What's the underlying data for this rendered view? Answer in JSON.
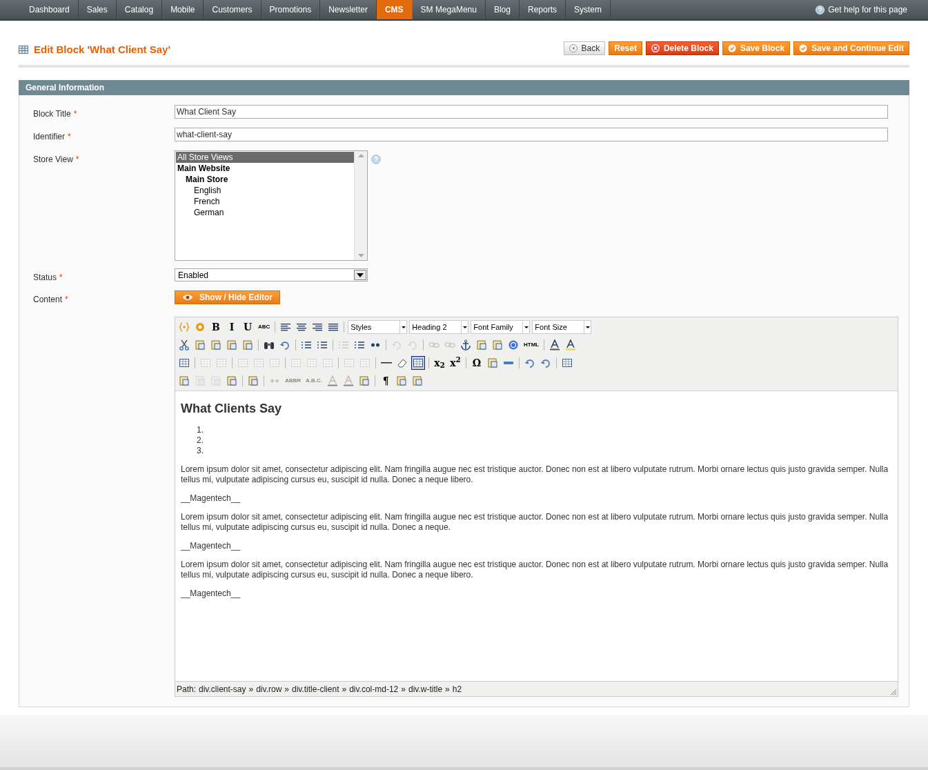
{
  "nav": {
    "items": [
      {
        "label": "Dashboard",
        "selected": false
      },
      {
        "label": "Sales",
        "selected": false
      },
      {
        "label": "Catalog",
        "selected": false
      },
      {
        "label": "Mobile",
        "selected": false
      },
      {
        "label": "Customers",
        "selected": false
      },
      {
        "label": "Promotions",
        "selected": false
      },
      {
        "label": "Newsletter",
        "selected": false
      },
      {
        "label": "CMS",
        "selected": true
      },
      {
        "label": "SM MegaMenu",
        "selected": false
      },
      {
        "label": "Blog",
        "selected": false
      },
      {
        "label": "Reports",
        "selected": false
      },
      {
        "label": "System",
        "selected": false
      }
    ],
    "help": "Get help for this page"
  },
  "header": {
    "title": "Edit Block 'What Client Say'",
    "buttons": [
      {
        "label": "Back",
        "kind": "back"
      },
      {
        "label": "Reset",
        "kind": "plain"
      },
      {
        "label": "Delete Block",
        "kind": "delete"
      },
      {
        "label": "Save Block",
        "kind": "save"
      },
      {
        "label": "Save and Continue Edit",
        "kind": "save"
      }
    ]
  },
  "section": {
    "title": "General Information"
  },
  "form": {
    "block_title": {
      "label": "Block Title",
      "required": "*",
      "value": "What Client Say"
    },
    "identifier": {
      "label": "Identifier",
      "required": "*",
      "value": "what-client-say"
    },
    "store_view": {
      "label": "Store View",
      "required": "*",
      "options": [
        {
          "label": "All Store Views",
          "selected": true,
          "bold": false
        },
        {
          "label": "Main Website",
          "selected": false,
          "bold": true,
          "children": [
            {
              "label": "Main Store",
              "selected": false,
              "bold": true,
              "children": [
                {
                  "label": "English",
                  "selected": false,
                  "bold": false
                },
                {
                  "label": "French",
                  "selected": false,
                  "bold": false
                },
                {
                  "label": "German",
                  "selected": false,
                  "bold": false
                }
              ]
            }
          ]
        }
      ]
    },
    "status": {
      "label": "Status",
      "required": "*",
      "value": "Enabled"
    },
    "content": {
      "label": "Content",
      "required": "*",
      "toggle": "Show / Hide Editor"
    }
  },
  "editor": {
    "toolbar": [
      [
        {
          "kind": "button",
          "disabled": false
        },
        {
          "kind": "button",
          "disabled": false
        },
        {
          "kind": "glyph",
          "text": "B",
          "disabled": false
        },
        {
          "kind": "glyph",
          "text": "I",
          "disabled": false
        },
        {
          "kind": "glyph",
          "text": "U",
          "disabled": false
        },
        {
          "kind": "glyph",
          "text": "ABC",
          "disabled": false
        },
        {
          "kind": "separator"
        },
        {
          "kind": "button",
          "disabled": false
        },
        {
          "kind": "button",
          "disabled": false
        },
        {
          "kind": "button",
          "disabled": false
        },
        {
          "kind": "button",
          "disabled": false
        },
        {
          "kind": "separator"
        },
        {
          "kind": "select",
          "value": "Styles"
        },
        {
          "kind": "select",
          "value": "Heading 2"
        },
        {
          "kind": "select",
          "value": "Font Family"
        },
        {
          "kind": "select",
          "value": "Font Size"
        }
      ],
      [
        {
          "kind": "button",
          "disabled": false
        },
        {
          "kind": "button",
          "disabled": false
        },
        {
          "kind": "button",
          "disabled": false
        },
        {
          "kind": "button",
          "disabled": false
        },
        {
          "kind": "button",
          "disabled": false
        },
        {
          "kind": "separator"
        },
        {
          "kind": "button",
          "disabled": false
        },
        {
          "kind": "button",
          "disabled": false
        },
        {
          "kind": "separator"
        },
        {
          "kind": "button",
          "disabled": false
        },
        {
          "kind": "button",
          "disabled": false
        },
        {
          "kind": "separator"
        },
        {
          "kind": "button",
          "disabled": true
        },
        {
          "kind": "button",
          "disabled": false
        },
        {
          "kind": "button",
          "disabled": false
        },
        {
          "kind": "separator"
        },
        {
          "kind": "button",
          "disabled": true
        },
        {
          "kind": "button",
          "disabled": true
        },
        {
          "kind": "separator"
        },
        {
          "kind": "button",
          "disabled": true
        },
        {
          "kind": "button",
          "disabled": true
        },
        {
          "kind": "button",
          "disabled": false
        },
        {
          "kind": "button",
          "disabled": false
        },
        {
          "kind": "button",
          "disabled": false
        },
        {
          "kind": "button",
          "disabled": false
        },
        {
          "kind": "glyph",
          "text": "HTML",
          "disabled": false
        },
        {
          "kind": "separator"
        },
        {
          "kind": "button",
          "disabled": false
        },
        {
          "kind": "button",
          "disabled": false
        }
      ],
      [
        {
          "kind": "button",
          "disabled": false
        },
        {
          "kind": "separator"
        },
        {
          "kind": "button",
          "disabled": true
        },
        {
          "kind": "button",
          "disabled": true
        },
        {
          "kind": "separator"
        },
        {
          "kind": "button",
          "disabled": true
        },
        {
          "kind": "button",
          "disabled": true
        },
        {
          "kind": "button",
          "disabled": true
        },
        {
          "kind": "separator"
        },
        {
          "kind": "button",
          "disabled": true
        },
        {
          "kind": "button",
          "disabled": true
        },
        {
          "kind": "button",
          "disabled": true
        },
        {
          "kind": "separator"
        },
        {
          "kind": "button",
          "disabled": true
        },
        {
          "kind": "button",
          "disabled": true
        },
        {
          "kind": "separator"
        },
        {
          "kind": "button",
          "disabled": false
        },
        {
          "kind": "button",
          "disabled": false
        },
        {
          "kind": "button",
          "disabled": false,
          "active": true
        },
        {
          "kind": "separator"
        },
        {
          "kind": "glyph",
          "text": "x$_{2}$",
          "disabled": false
        },
        {
          "kind": "glyph",
          "text": "x$^{2}$",
          "disabled": false
        },
        {
          "kind": "separator"
        },
        {
          "kind": "glyph",
          "text": "Ω",
          "disabled": false
        },
        {
          "kind": "button",
          "disabled": false
        },
        {
          "kind": "button",
          "disabled": false
        },
        {
          "kind": "separator"
        },
        {
          "kind": "button",
          "disabled": false
        },
        {
          "kind": "button",
          "disabled": false
        },
        {
          "kind": "separator"
        },
        {
          "kind": "button",
          "disabled": false
        }
      ],
      [
        {
          "kind": "button",
          "disabled": false
        },
        {
          "kind": "button",
          "disabled": true
        },
        {
          "kind": "button",
          "disabled": true
        },
        {
          "kind": "button",
          "disabled": false
        },
        {
          "kind": "separator"
        },
        {
          "kind": "button",
          "disabled": false
        },
        {
          "kind": "separator"
        },
        {
          "kind": "button",
          "disabled": true
        },
        {
          "kind": "glyph",
          "text": "ABBR",
          "disabled": true
        },
        {
          "kind": "glyph",
          "text": "A.B.C.",
          "disabled": true
        },
        {
          "kind": "button",
          "disabled": true
        },
        {
          "kind": "button",
          "disabled": true
        },
        {
          "kind": "button",
          "disabled": false
        },
        {
          "kind": "separator"
        },
        {
          "kind": "glyph",
          "text": "¶",
          "disabled": false
        },
        {
          "kind": "button",
          "disabled": false
        },
        {
          "kind": "button",
          "disabled": false
        }
      ]
    ],
    "content": [
      {
        "kind": "heading",
        "text": "What Clients Say"
      },
      {
        "kind": "list",
        "items": [
          "1.",
          "2.",
          "3."
        ]
      },
      {
        "kind": "paragraph",
        "text": "Lorem ipsum dolor sit amet, consectetur adipiscing elit. Nam fringilla augue nec est tristique auctor. Donec non est at libero vulputate rutrum. Morbi ornare lectus quis justo gravida semper. Nulla tellus mi, vulputate adipiscing cursus eu, suscipit id nulla. Donec a neque libero."
      },
      {
        "kind": "paragraph",
        "text": "__Magentech__"
      },
      {
        "kind": "paragraph",
        "text": "Lorem ipsum dolor sit amet, consectetur adipiscing elit. Nam fringilla augue nec est tristique auctor. Donec non est at libero vulputate rutrum. Morbi ornare lectus quis justo gravida semper. Nulla tellus mi, vulputate adipiscing cursus eu, suscipit id nulla. Donec a neque."
      },
      {
        "kind": "paragraph",
        "text": "__Magentech__"
      },
      {
        "kind": "paragraph",
        "text": "Lorem ipsum dolor sit amet, consectetur adipiscing elit. Nam fringilla augue nec est tristique auctor. Donec non est at libero vulputate rutrum. Morbi ornare lectus quis justo gravida semper. Nulla tellus mi, vulputate adipiscing cursus eu, suscipit id nulla. Donec a neque libero."
      },
      {
        "kind": "paragraph",
        "text": "__Magentech__"
      }
    ],
    "path": {
      "label": "Path:",
      "parts": [
        "div.client-say",
        "div.row",
        "div.title-client",
        "div.col-md-12",
        "div.w-title",
        "h2"
      ],
      "separator": "»"
    }
  }
}
